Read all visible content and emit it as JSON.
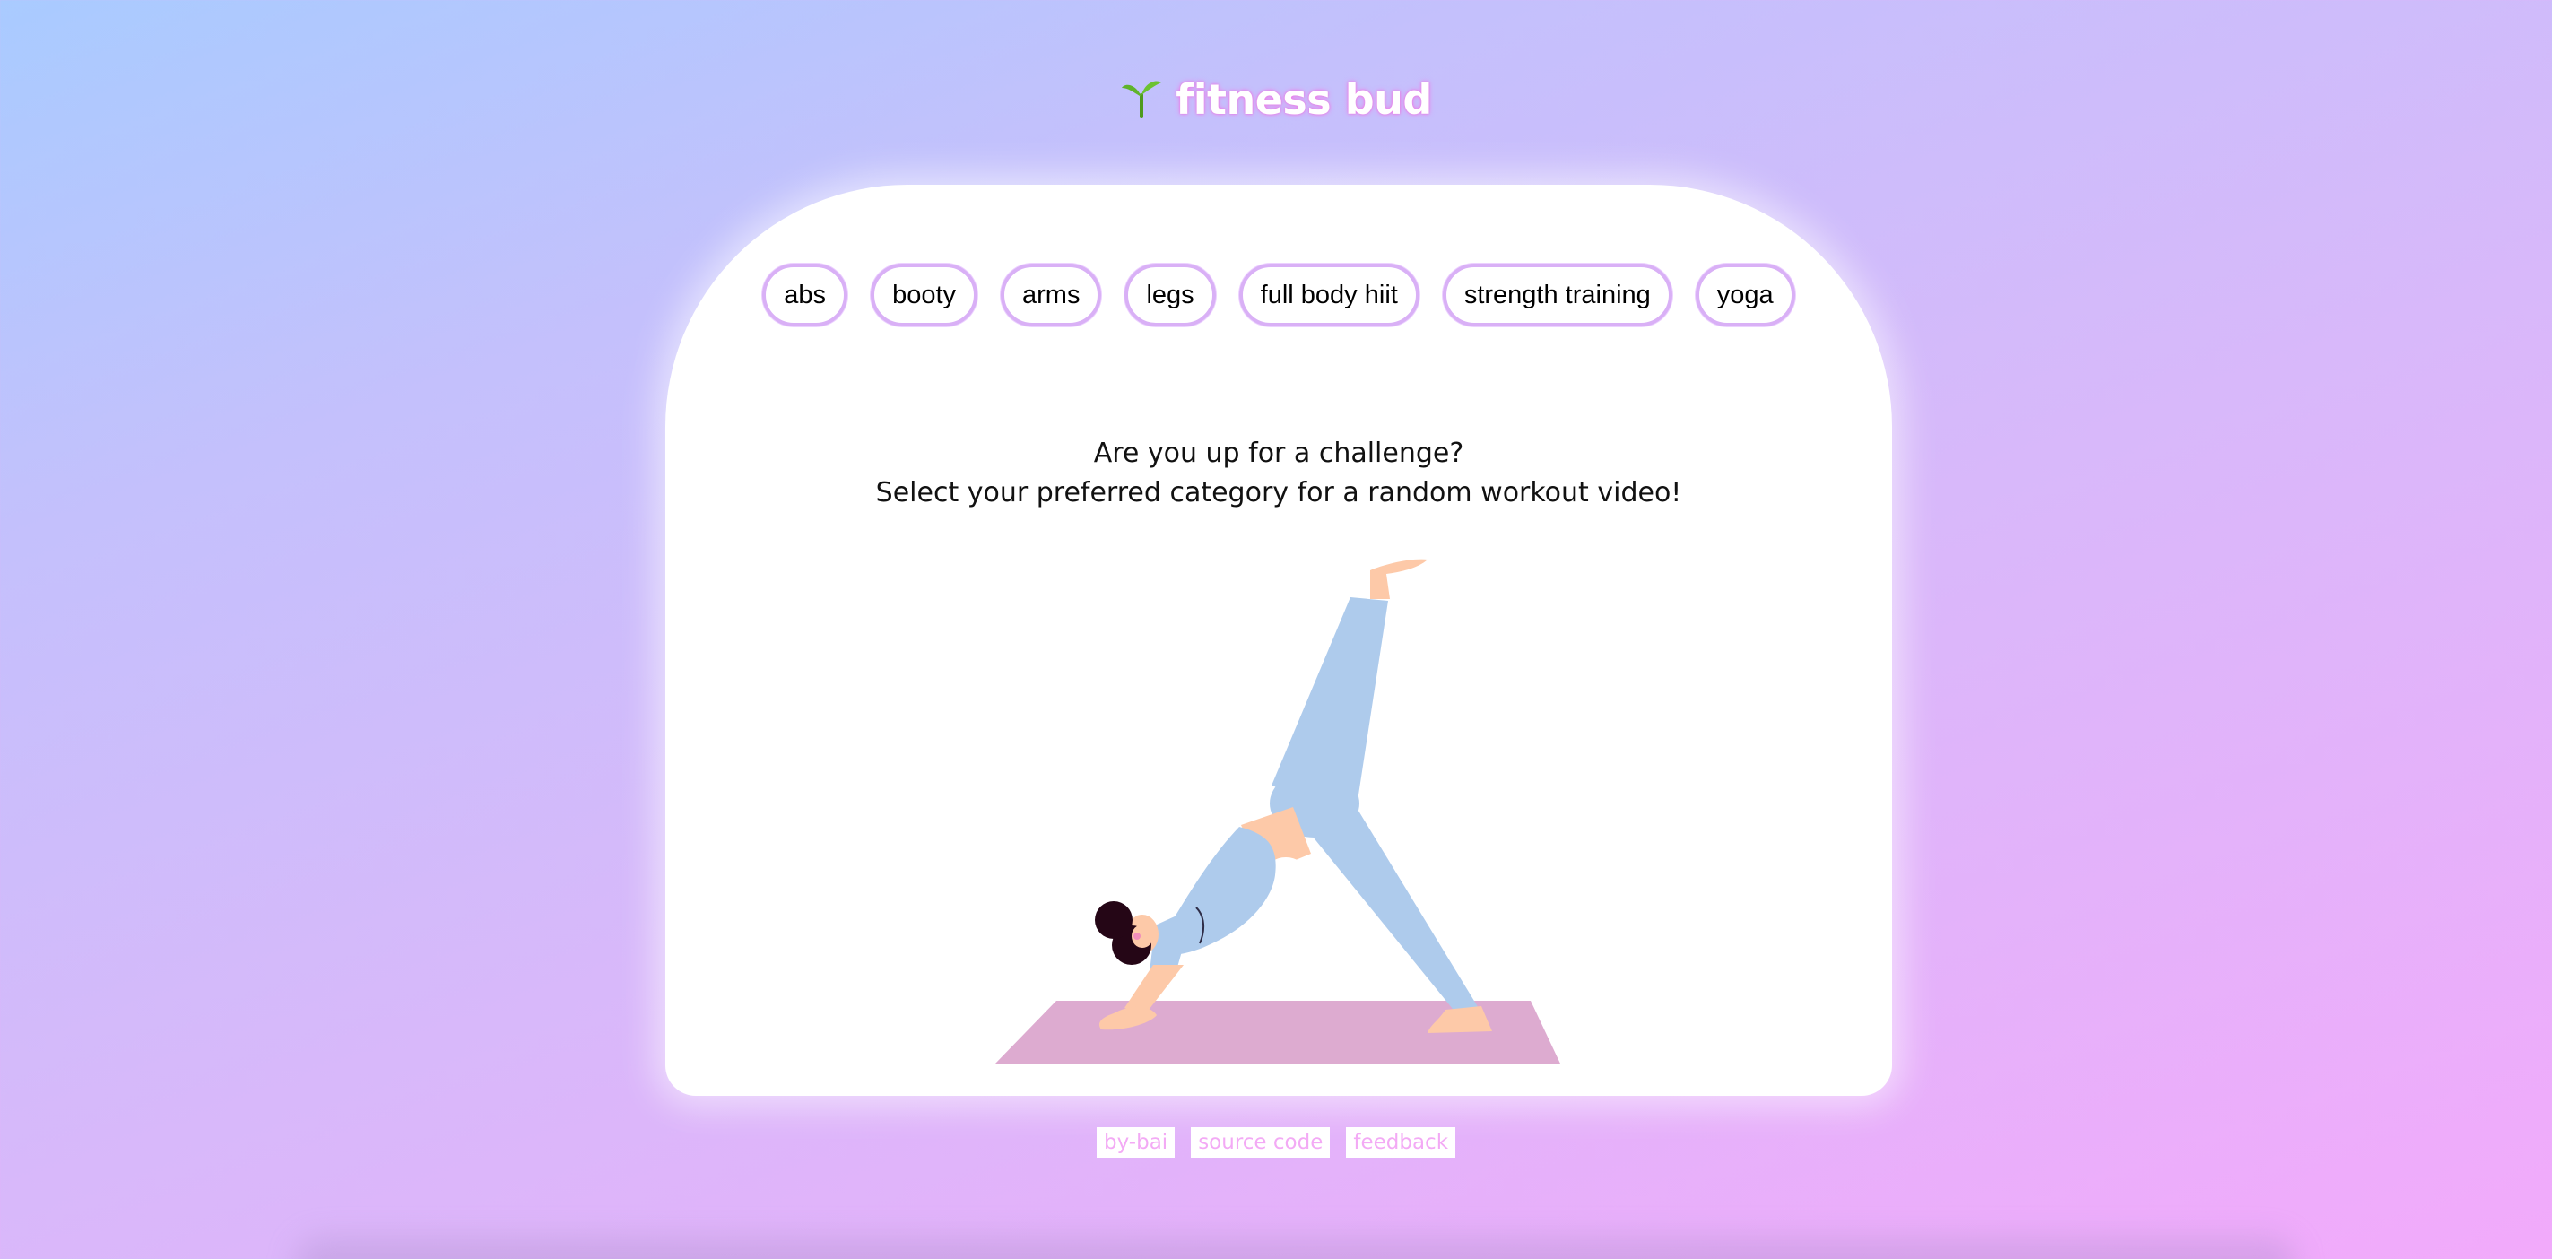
{
  "header": {
    "title": "fitness bud",
    "logo_icon": "seedling-icon"
  },
  "categories": [
    {
      "label": "abs"
    },
    {
      "label": "booty"
    },
    {
      "label": "arms"
    },
    {
      "label": "legs"
    },
    {
      "label": "full body hiit"
    },
    {
      "label": "strength training"
    },
    {
      "label": "yoga"
    }
  ],
  "prompt": {
    "line1": "Are you up for a challenge?",
    "line2": "Select your preferred category for a random workout video!"
  },
  "footer": {
    "links": [
      {
        "label": "by-bai"
      },
      {
        "label": "source code"
      },
      {
        "label": "feedback"
      }
    ]
  },
  "colors": {
    "button_border": "#d9b0f6",
    "footer_text": "#f3aaf5",
    "mat": "#ddabd0",
    "clothing": "#aecbec",
    "skin": "#fdc9a8",
    "hair": "#250616"
  }
}
